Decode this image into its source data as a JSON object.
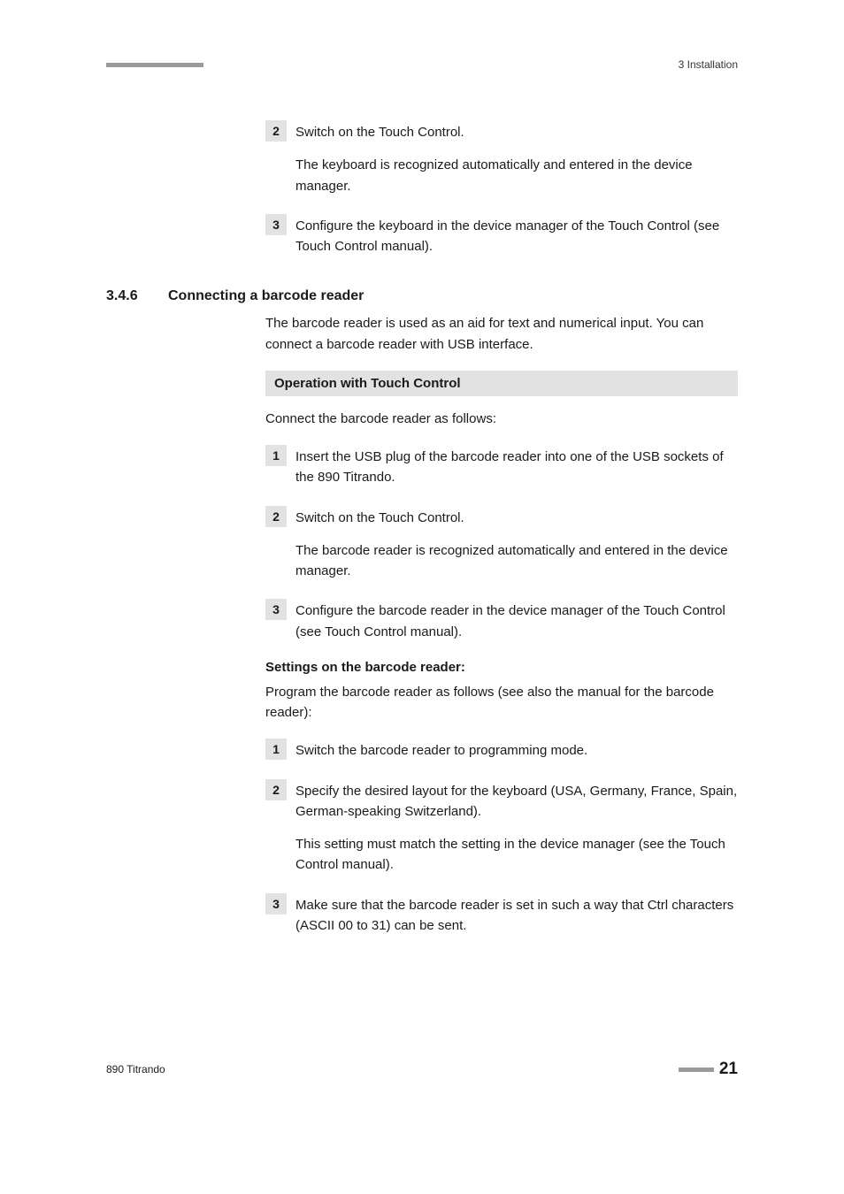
{
  "header": {
    "section_label": "3 Installation"
  },
  "body": {
    "top_steps": [
      {
        "num": "2",
        "paras": [
          "Switch on the Touch Control.",
          "The keyboard is recognized automatically and entered in the device manager."
        ]
      },
      {
        "num": "3",
        "paras": [
          "Configure the keyboard in the device manager of the Touch Control (see Touch Control manual)."
        ]
      }
    ],
    "section": {
      "num": "3.4.6",
      "title": "Connecting a barcode reader",
      "intro": "The barcode reader is used as an aid for text and numerical input. You can connect a barcode reader with USB interface.",
      "sub1_title": "Operation with Touch Control",
      "sub1_intro": "Connect the barcode reader as follows:",
      "sub1_steps": [
        {
          "num": "1",
          "paras": [
            "Insert the USB plug of the barcode reader into one of the USB sockets of the 890 Titrando."
          ]
        },
        {
          "num": "2",
          "paras": [
            "Switch on the Touch Control.",
            "The barcode reader is recognized automatically and entered in the device manager."
          ]
        },
        {
          "num": "3",
          "paras": [
            "Configure the barcode reader in the device manager of the Touch Control (see Touch Control manual)."
          ]
        }
      ],
      "sub2_title": "Settings on the barcode reader:",
      "sub2_intro": "Program the barcode reader as follows (see also the manual for the barcode reader):",
      "sub2_steps": [
        {
          "num": "1",
          "paras": [
            "Switch the barcode reader to programming mode."
          ]
        },
        {
          "num": "2",
          "paras": [
            "Specify the desired layout for the keyboard (USA, Germany, France, Spain, German-speaking Switzerland).",
            "This setting must match the setting in the device manager (see the Touch Control manual)."
          ]
        },
        {
          "num": "3",
          "paras": [
            "Make sure that the barcode reader is set in such a way that Ctrl characters (ASCII 00 to 31) can be sent."
          ]
        }
      ]
    }
  },
  "footer": {
    "product": "890 Titrando",
    "page": "21"
  }
}
